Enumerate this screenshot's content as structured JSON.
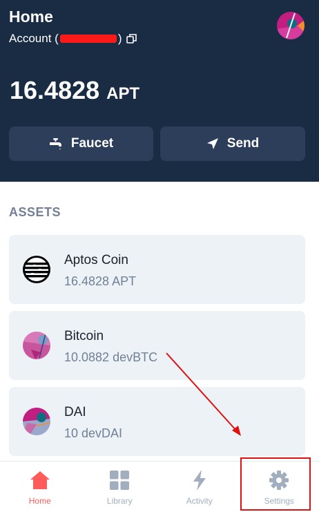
{
  "header": {
    "title": "Home",
    "account_prefix": "Account (",
    "account_suffix": ")",
    "balance_amount": "16.4828",
    "balance_unit": "APT"
  },
  "actions": {
    "faucet_label": "Faucet",
    "send_label": "Send"
  },
  "assets": {
    "heading": "ASSETS",
    "items": [
      {
        "name": "Aptos Coin",
        "amount": "16.4828 APT"
      },
      {
        "name": "Bitcoin",
        "amount": "10.0882 devBTC"
      },
      {
        "name": "DAI",
        "amount": "10 devDAI"
      }
    ]
  },
  "nav": {
    "items": [
      {
        "label": "Home",
        "icon": "home-icon",
        "active": true
      },
      {
        "label": "Library",
        "icon": "library-icon",
        "active": false
      },
      {
        "label": "Activity",
        "icon": "activity-icon",
        "active": false
      },
      {
        "label": "Settings",
        "icon": "settings-icon",
        "active": false
      }
    ]
  },
  "colors": {
    "header_bg": "#1a2b44",
    "button_bg": "#2c3e59",
    "card_bg": "#edf2f7",
    "nav_active": "#ff5b5b",
    "nav_inactive": "#a0aec0",
    "annotation": "#e01010"
  }
}
